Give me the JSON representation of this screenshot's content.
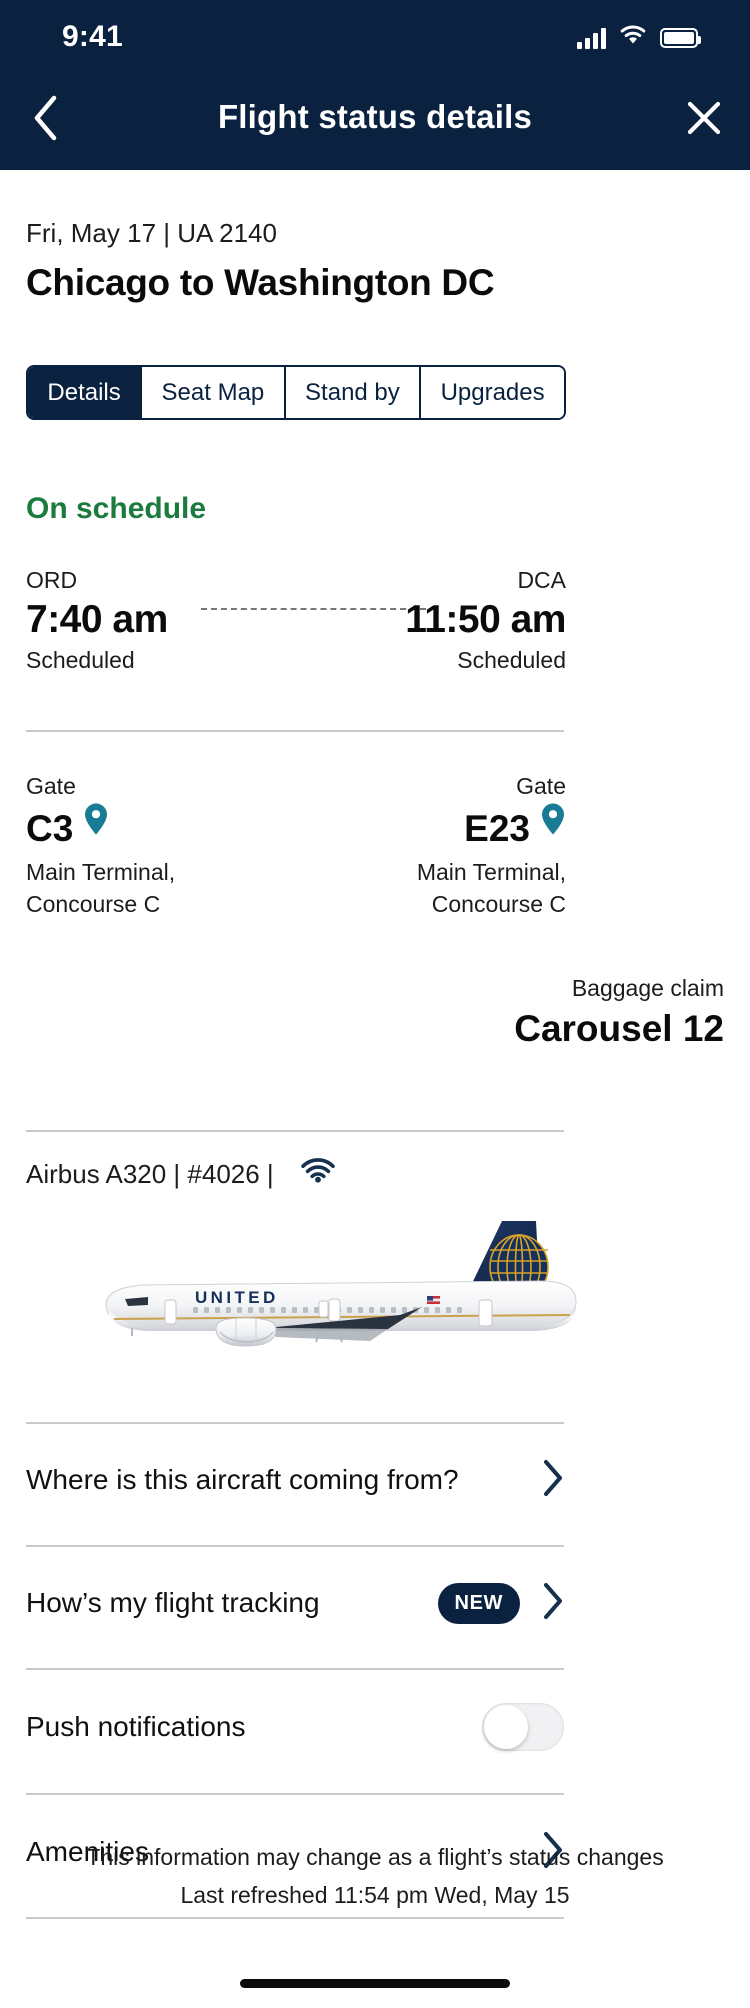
{
  "status_bar": {
    "time": "9:41",
    "icons": [
      "cellular-signal-icon",
      "wifi-icon",
      "battery-icon"
    ]
  },
  "nav": {
    "title": "Flight status details",
    "back_icon": "chevron-left-icon",
    "close_icon": "close-icon"
  },
  "flight": {
    "meta": "Fri, May 17 | UA 2140",
    "route": "Chicago to Washington DC"
  },
  "tabs": [
    {
      "label": "Details",
      "active": true
    },
    {
      "label": "Seat Map",
      "active": false
    },
    {
      "label": "Stand by",
      "active": false
    },
    {
      "label": "Upgrades",
      "active": false
    }
  ],
  "schedule": {
    "status": "On schedule",
    "status_color": "#1d7a3e",
    "origin": {
      "code": "ORD",
      "time": "7:40 am",
      "sub": "Scheduled"
    },
    "destination": {
      "code": "DCA",
      "time": "11:50 am",
      "sub": "Scheduled"
    }
  },
  "gates": {
    "origin": {
      "label": "Gate",
      "value": "C3",
      "sub_line1": "Main Terminal,",
      "sub_line2": "Concourse C",
      "pin_icon": "map-pin-icon"
    },
    "destination": {
      "label": "Gate",
      "value": "E23",
      "sub_line1": "Main Terminal,",
      "sub_line2": "Concourse C",
      "pin_icon": "map-pin-icon"
    }
  },
  "baggage": {
    "label": "Baggage claim",
    "value": "Carousel 12"
  },
  "aircraft": {
    "text": "Airbus A320 | #4026 |",
    "wifi_icon": "wifi-icon",
    "livery_text": "UNITED",
    "image_name": "united-airbus-a320-side-view"
  },
  "rows": [
    {
      "label": "Where is this aircraft coming from?",
      "badge": null,
      "control": "chevron",
      "name": "row-aircraft-origin"
    },
    {
      "label": "How’s my flight tracking",
      "badge": "NEW",
      "control": "chevron",
      "name": "row-flight-tracking"
    },
    {
      "label": "Push notifications",
      "badge": null,
      "control": "toggle",
      "toggle_on": false,
      "name": "row-push-notifications"
    },
    {
      "label": "Amenities",
      "badge": null,
      "control": "chevron",
      "name": "row-amenities"
    }
  ],
  "footer": {
    "line1": "This information may change as a flight’s status changes",
    "line2": "Last refreshed 11:54 pm Wed, May 15"
  },
  "colors": {
    "brand_navy": "#0a2240",
    "status_green": "#1d7a3e",
    "pin_teal": "#1a7b96",
    "divider": "#c9cace"
  }
}
